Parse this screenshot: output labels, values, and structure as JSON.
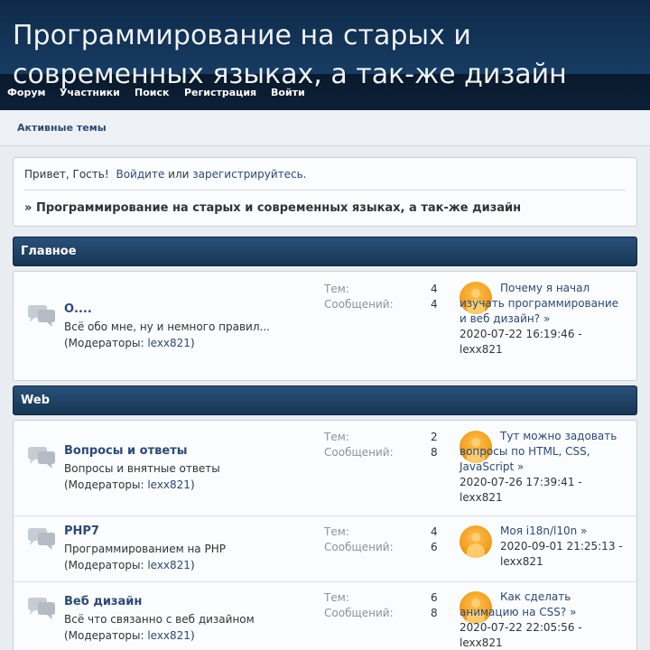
{
  "site": {
    "title": "Программирование на старых и современных языках, а так-же дизайн"
  },
  "menu": {
    "items": [
      "Форум",
      "Участники",
      "Поиск",
      "Регистрация",
      "Войти"
    ]
  },
  "subnav": {
    "active_topics": "Активные темы"
  },
  "welcome": {
    "greeting": "Привет, Гость!",
    "login": "Войдите",
    "or": "или",
    "register": "зарегистрируйтесь.",
    "breadcrumb_marker": "»",
    "breadcrumb": "Программирование на старых и современных языках, а так-же дизайн"
  },
  "labels": {
    "topics": "Тем:",
    "posts": "Сообщений:",
    "moderators_prefix": "(Модераторы:",
    "moderators_suffix": ")",
    "arrow": "»"
  },
  "categories": [
    {
      "name": "Главное",
      "boards": [
        {
          "name": "О....",
          "description": "Всё обо мне, ну и немного правил...",
          "moderator": "lexx821",
          "topics": "4",
          "posts": "4",
          "last_topic": "Почему я начал изучать программирование и веб дизайн?",
          "last_date": "2020-07-22 16:19:46",
          "last_user": "lexx821"
        }
      ]
    },
    {
      "name": "Web",
      "boards": [
        {
          "name": "Вопросы и ответы",
          "description": "Вопросы и внятные ответы",
          "moderator": "lexx821",
          "topics": "2",
          "posts": "8",
          "last_topic": "Тут можно задовать вопросы по HTML, CSS, JavaScript",
          "last_date": "2020-07-26 17:39:41",
          "last_user": "lexx821"
        },
        {
          "name": "PHP7",
          "description": "Программированием на PHP",
          "moderator": "lexx821",
          "topics": "4",
          "posts": "6",
          "last_topic": "Моя i18n/l10n",
          "last_date": "2020-09-01 21:25:13",
          "last_user": "lexx821"
        },
        {
          "name": "Веб дизайн",
          "description": "Всё что связанно с веб дизайном",
          "moderator": "lexx821",
          "topics": "6",
          "posts": "8",
          "last_topic": "Как сделать анимацию на CSS?",
          "last_date": "2020-07-22 22:05:56",
          "last_user": "lexx821"
        }
      ]
    }
  ]
}
